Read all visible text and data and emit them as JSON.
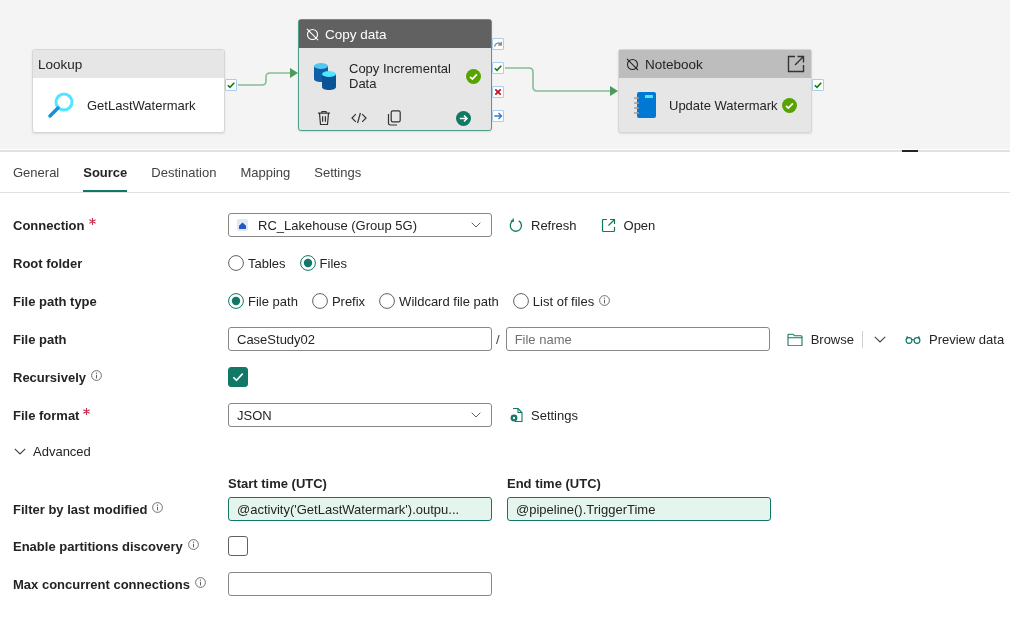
{
  "canvas": {
    "activities": [
      {
        "kind": "lookup",
        "type": "Lookup",
        "name": "GetLastWatermark",
        "selected": false,
        "deactivated": false,
        "succeeded": false,
        "ports": [
          {
            "kind": "success"
          }
        ]
      },
      {
        "kind": "copy",
        "type": "Copy data",
        "name": "Copy Incremental Data",
        "selected": true,
        "deactivated": true,
        "succeeded": true,
        "ports": [
          {
            "kind": "skip"
          },
          {
            "kind": "success"
          },
          {
            "kind": "failure"
          },
          {
            "kind": "completion"
          }
        ]
      },
      {
        "kind": "notebook",
        "type": "Notebook",
        "name": "Update Watermark",
        "selected": false,
        "deactivated": true,
        "succeeded": true,
        "ports": [
          {
            "kind": "success"
          }
        ]
      }
    ]
  },
  "tabs": [
    {
      "label": "General",
      "selected": false
    },
    {
      "label": "Source",
      "selected": true
    },
    {
      "label": "Destination",
      "selected": false
    },
    {
      "label": "Mapping",
      "selected": false
    },
    {
      "label": "Settings",
      "selected": false
    }
  ],
  "form": {
    "rows": [
      {
        "kind": "connection",
        "label": "Connection",
        "required": true,
        "info": false,
        "value": "RC_Lakehouse (Group 5G)",
        "actions": [
          {
            "kind": "refresh",
            "label": "Refresh",
            "menu": false
          },
          {
            "kind": "open",
            "label": "Open",
            "menu": false
          }
        ]
      },
      {
        "kind": "radio",
        "label": "Root folder",
        "required": false,
        "info": false,
        "options": [
          {
            "label": "Tables",
            "selected": false,
            "info": false
          },
          {
            "label": "Files",
            "selected": true,
            "info": false
          }
        ]
      },
      {
        "kind": "radio",
        "label": "File path type",
        "required": false,
        "info": false,
        "options": [
          {
            "label": "File path",
            "selected": true,
            "info": false
          },
          {
            "label": "Prefix",
            "selected": false,
            "info": false
          },
          {
            "label": "Wildcard file path",
            "selected": false,
            "info": false
          },
          {
            "label": "List of files",
            "selected": false,
            "info": true
          }
        ]
      },
      {
        "kind": "path",
        "label": "File path",
        "required": false,
        "info": false,
        "folder": {
          "value": "CaseStudy02"
        },
        "separator": "/",
        "file": {
          "placeholder": "File name"
        },
        "actions": [
          {
            "kind": "browse",
            "label": "Browse",
            "menu": true
          },
          {
            "kind": "preview",
            "label": "Preview data",
            "menu": false
          }
        ]
      },
      {
        "kind": "checkbox",
        "label": "Recursively",
        "required": false,
        "info": true,
        "checked": true
      },
      {
        "kind": "dropdown",
        "label": "File format",
        "required": true,
        "info": false,
        "value": "JSON",
        "actions": [
          {
            "kind": "settings",
            "label": "Settings",
            "menu": false
          }
        ]
      },
      {
        "kind": "section",
        "label": "Advanced",
        "required": false,
        "info": false,
        "expanded": true
      },
      {
        "kind": "time_range",
        "label": "Filter by last modified",
        "required": false,
        "info": true,
        "fields": [
          {
            "heading": "Start time (UTC)",
            "value": "@activity('GetLastWatermark').outpu...",
            "dynamic": true
          },
          {
            "heading": "End time (UTC)",
            "value": "@pipeline().TriggerTime",
            "dynamic": true
          }
        ]
      },
      {
        "kind": "checkbox",
        "label": "Enable partitions discovery",
        "required": false,
        "info": true,
        "checked": false
      },
      {
        "kind": "text",
        "label": "Max concurrent connections",
        "required": false,
        "info": true
      }
    ]
  }
}
